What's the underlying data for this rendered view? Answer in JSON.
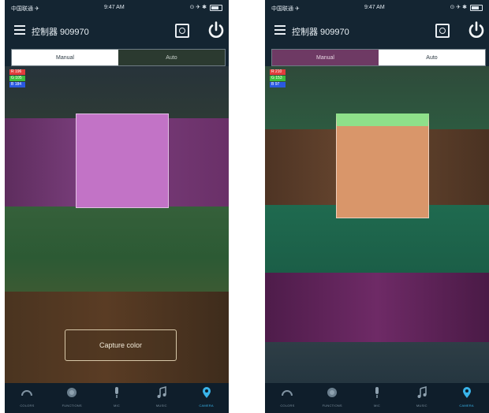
{
  "screens": [
    {
      "status": {
        "carrier": "中国联通 ✈",
        "time": "9:47 AM",
        "sys": "⊙ ✈ ✱"
      },
      "header": {
        "title": "控制器 909970"
      },
      "tabs": [
        {
          "label": "Manual",
          "state": "active"
        },
        {
          "label": "Auto",
          "state": "inactive"
        }
      ],
      "rgb": [
        {
          "label": "R 196",
          "color": "#e23c3c"
        },
        {
          "label": "G 105",
          "color": "#3fbf3f"
        },
        {
          "label": "B 184",
          "color": "#2b59e0"
        }
      ],
      "sample_color": "#c273c6",
      "capture_label": "Capture color",
      "nav": [
        {
          "label": "COLORS",
          "icon": "colors-gauge-icon"
        },
        {
          "label": "FUNCTIONS",
          "icon": "functions-dial-icon"
        },
        {
          "label": "MIC",
          "icon": "microphone-icon"
        },
        {
          "label": "MUSIC",
          "icon": "music-note-icon"
        },
        {
          "label": "CAMERA",
          "icon": "camera-pin-icon",
          "active": true
        }
      ]
    },
    {
      "status": {
        "carrier": "中国联通 ✈",
        "time": "9:47 AM",
        "sys": "⊙ ✈ ✱"
      },
      "header": {
        "title": "控制器 909970"
      },
      "tabs": [
        {
          "label": "Manual",
          "state": "inactive"
        },
        {
          "label": "Auto",
          "state": "active"
        }
      ],
      "rgb": [
        {
          "label": "R 210",
          "color": "#e23c3c"
        },
        {
          "label": "G 153",
          "color": "#3fbf3f"
        },
        {
          "label": "B 97",
          "color": "#2b59e0"
        }
      ],
      "sample_color": "#d9966a",
      "nav": [
        {
          "label": "COLORS",
          "icon": "colors-gauge-icon"
        },
        {
          "label": "FUNCTIONS",
          "icon": "functions-dial-icon"
        },
        {
          "label": "MIC",
          "icon": "microphone-icon"
        },
        {
          "label": "MUSIC",
          "icon": "music-note-icon"
        },
        {
          "label": "CAMERA",
          "icon": "camera-pin-icon",
          "active": true
        }
      ]
    }
  ]
}
